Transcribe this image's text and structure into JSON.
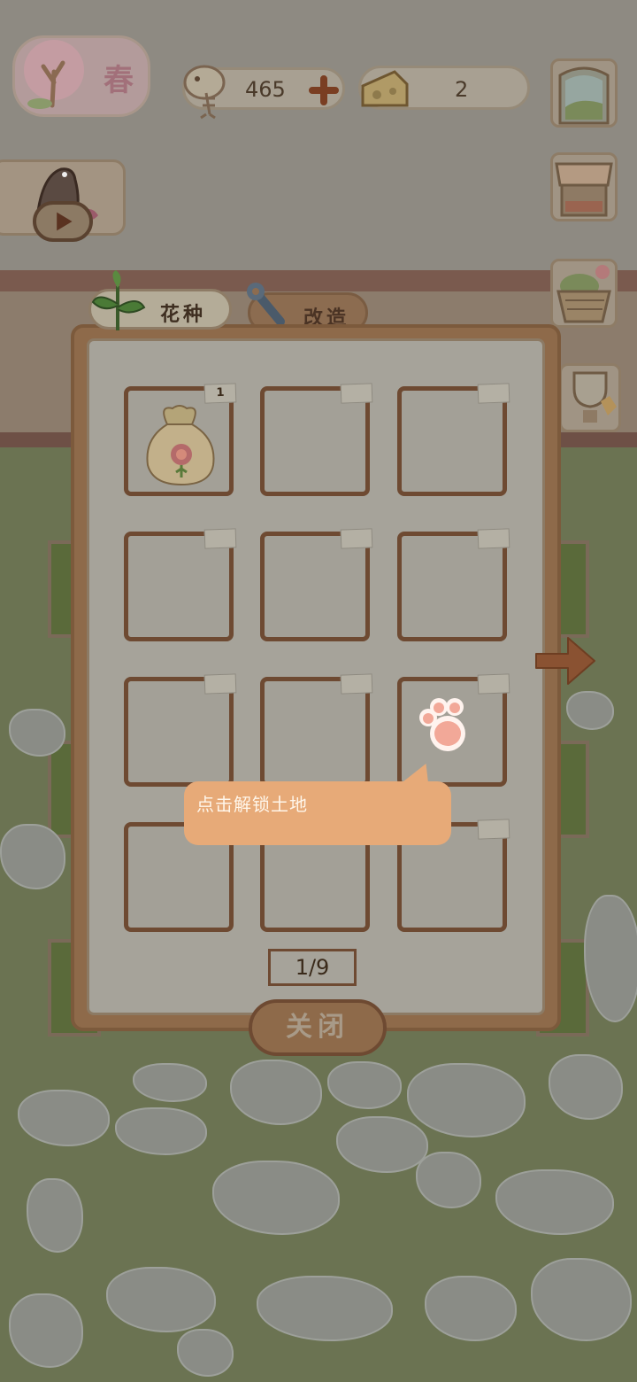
{
  "hud": {
    "season": "春",
    "fish_count": "465",
    "cheese_count": "2"
  },
  "tabs": {
    "seeds": "花种",
    "modify": "改造"
  },
  "grid": {
    "slots": [
      {
        "tag": "1",
        "has_item": true,
        "item": "seed-bag"
      },
      {
        "tag": "",
        "has_item": false
      },
      {
        "tag": "",
        "has_item": false
      },
      {
        "tag": "",
        "has_item": false
      },
      {
        "tag": "",
        "has_item": false
      },
      {
        "tag": "",
        "has_item": false
      },
      {
        "tag": "",
        "has_item": false
      },
      {
        "tag": "",
        "has_item": false
      },
      {
        "tag": "",
        "has_item": false
      },
      {
        "tag": "",
        "has_item": false
      },
      {
        "tag": "",
        "has_item": false
      },
      {
        "tag": "",
        "has_item": false
      }
    ],
    "page": "1/9"
  },
  "tutorial": {
    "tooltip": "点击解锁土地"
  },
  "buttons": {
    "close": "关闭"
  },
  "colors": {
    "panel_frame": "#8e6a4a",
    "tooltip": "#e7aa78",
    "paw": "#f2a898"
  },
  "icons": [
    "tree-icon",
    "fish-bone-icon",
    "plus-icon",
    "cheese-icon",
    "window-icon",
    "shop-icon",
    "basket-icon",
    "trophy-icon",
    "play-icon",
    "sprout-icon",
    "wrench-icon",
    "seed-bag-icon",
    "paw-icon",
    "arrow-right-icon"
  ]
}
